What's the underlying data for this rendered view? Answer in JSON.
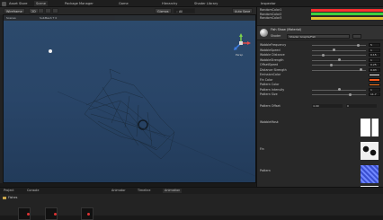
{
  "top_tabs": [
    {
      "label": "Asset Store"
    },
    {
      "label": "Scene"
    },
    {
      "label": "Package Manager"
    },
    {
      "label": "Game"
    },
    {
      "label": "Hierarchy"
    },
    {
      "label": "Shader Library"
    }
  ],
  "toolbar": {
    "shading_mode": "Wireframe",
    "view_2d": "2D",
    "gizmos": "Gizmos",
    "search": "All",
    "persp_label": "Persp"
  },
  "scene_subtab": {
    "left": "Scenes",
    "right": "SubMesh T 0"
  },
  "scene_header_right": "Auto Save",
  "inspector": {
    "title": "Inspector",
    "top_rows": [
      {
        "label": "RandomColor1",
        "color": "#ff3030"
      },
      {
        "label": "RandomColor2",
        "color": "#40d040"
      },
      {
        "label": "RandomColor3",
        "color": "#e0c030"
      }
    ],
    "material_name": "Fish Shaw (Material)",
    "shader_label": "Shader",
    "shader_value": "Shader Graphs/Fish",
    "rows": [
      {
        "label": "WobbleFrequency",
        "value": "5",
        "level": 0.85
      },
      {
        "label": "WobbleSpeed",
        "value": "1",
        "level": 0.4
      },
      {
        "label": "Wobble Distance",
        "value": "0.15",
        "level": 0.2
      },
      {
        "label": "WobbleStrength",
        "value": "1",
        "level": 0.5
      },
      {
        "label": "OffsetSpeed",
        "value": "0.25",
        "level": 0.35
      },
      {
        "label": "Distance Strength",
        "value": "0.93",
        "level": 0.9
      },
      {
        "label": "EmissionColor",
        "value": "",
        "level": null
      },
      {
        "label": "Fin Color",
        "value": "",
        "level": null
      },
      {
        "label": "Pattern Color",
        "value": "",
        "level": null
      },
      {
        "label": "Pattern Intensity",
        "value": "1",
        "level": 0.5
      },
      {
        "label": "Pattern Size",
        "value": "11.7",
        "level": 0.7
      }
    ],
    "pattern_offset": {
      "label": "Pattern Offset",
      "x": "4.99",
      "y": "0"
    },
    "textures": [
      {
        "label": "WobbleMask"
      },
      {
        "label": "Fin"
      },
      {
        "label": "Pattern"
      }
    ]
  },
  "bottom": {
    "tabs": [
      {
        "label": "Project"
      },
      {
        "label": "Console"
      },
      {
        "label": "Animator"
      },
      {
        "label": "Timeline"
      },
      {
        "label": "Animation"
      }
    ],
    "folder": "Fishes"
  }
}
